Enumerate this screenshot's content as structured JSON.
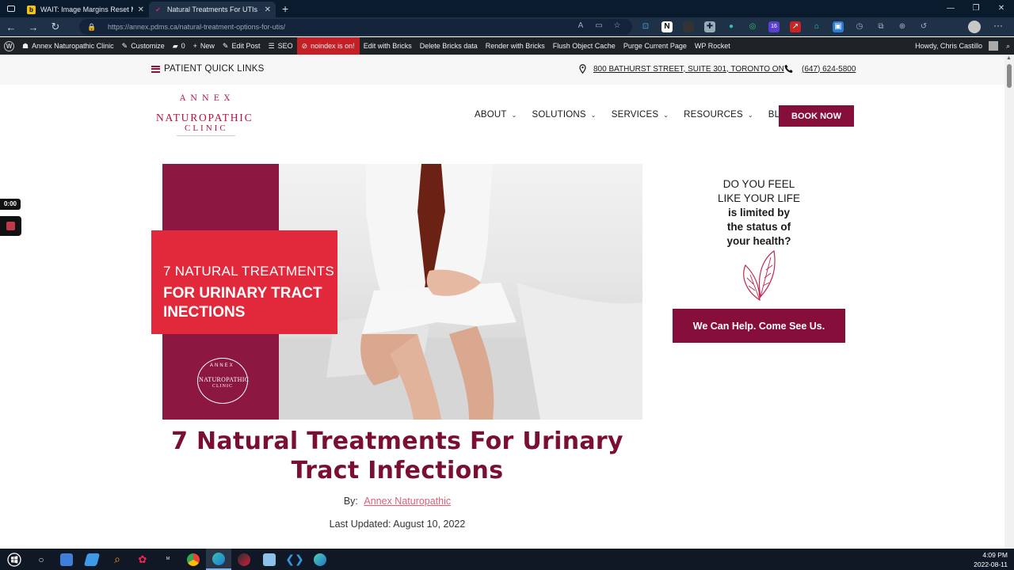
{
  "browser": {
    "tabs": [
      {
        "title": "WAIT: Image Margins Reset Man",
        "favicon": "b",
        "favicon_color": "#f1c40f"
      },
      {
        "title": "Natural Treatments For UTIs - He",
        "favicon": "✔",
        "favicon_color": "#e0245e"
      }
    ],
    "url_host": "https://annex.pdms.ca",
    "url_path": "/natural-treatment-options-for-utis/"
  },
  "wp_admin": {
    "site_name": "Annex Naturopathic Clinic",
    "customize": "Customize",
    "comments": "0",
    "new": "New",
    "edit_post": "Edit Post",
    "seo": "SEO",
    "noindex": "noindex is on!",
    "edit_bricks": "Edit with Bricks",
    "delete_bricks": "Delete Bricks data",
    "render_bricks": "Render with Bricks",
    "flush_cache": "Flush Object Cache",
    "purge_page": "Purge Current Page",
    "wp_rocket": "WP Rocket",
    "howdy": "Howdy, Chris Castillo"
  },
  "topbar": {
    "quick_links": "PATIENT QUICK LINKS",
    "address": "800 BATHURST STREET, SUITE 301, TORONTO ON",
    "phone": "(647) 624-5800"
  },
  "logo": {
    "line1": "ANNEX",
    "line2": "NATUROPATHIC",
    "line3": "CLINIC"
  },
  "nav": {
    "items": [
      "ABOUT",
      "SOLUTIONS",
      "SERVICES",
      "RESOURCES",
      "BLOG"
    ],
    "book_now": "BOOK NOW"
  },
  "hero": {
    "overlay_line1": "7 NATURAL TREATMENTS",
    "overlay_line2": "FOR URINARY TRACT INECTIONS",
    "mini_logo": {
      "a": "ANNEX",
      "n": "NATUROPATHIC",
      "c": "CLINIC"
    }
  },
  "sidebar": {
    "line1": "DO YOU FEEL",
    "line2": "LIKE YOUR LIFE",
    "line3": "is limited by",
    "line4": "the status of",
    "line5": "your health?",
    "cta": "We Can Help. Come See Us."
  },
  "article": {
    "title": "7 Natural Treatments For Urinary Tract Infections",
    "by_label": "By:",
    "author": "Annex Naturopathic",
    "updated": "Last Updated: August 10, 2022"
  },
  "recorder": {
    "time": "0:00"
  },
  "taskbar": {
    "time": "4:09 PM",
    "date": "2022-08-11"
  },
  "colors": {
    "brand": "#860e3a",
    "accent_red": "#e2293c",
    "link": "#d95f7a"
  }
}
